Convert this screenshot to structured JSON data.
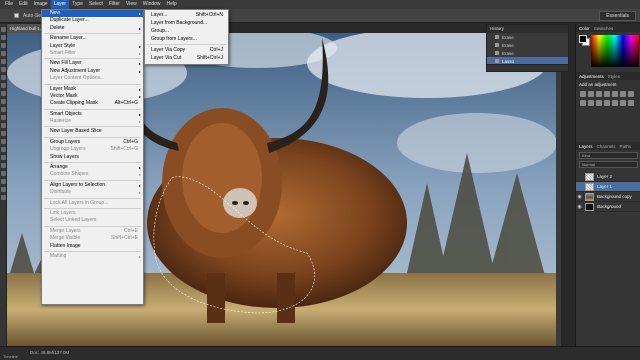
{
  "menubar": [
    "File",
    "Edit",
    "Image",
    "Layer",
    "Type",
    "Select",
    "Filter",
    "View",
    "Window",
    "Help"
  ],
  "options": {
    "auto_select": "Auto-Select:",
    "workspace": "Essentials"
  },
  "document_tab": "Highland bull 1.jpg @ 66.7% (Layer 1, RGB/8) *",
  "status_doc": "Doc: 46.8M/137.0M",
  "timeline": "Timeline",
  "layer_menu": [
    {
      "label": "New",
      "highlighted": true,
      "arrow": true
    },
    {
      "label": "Duplicate Layer..."
    },
    {
      "label": "Delete",
      "arrow": true
    },
    {
      "sep": true
    },
    {
      "label": "Rename Layer..."
    },
    {
      "label": "Layer Style",
      "arrow": true
    },
    {
      "label": "Smart Filter",
      "disabled": true,
      "arrow": true
    },
    {
      "sep": true
    },
    {
      "label": "New Fill Layer",
      "arrow": true
    },
    {
      "label": "New Adjustment Layer",
      "arrow": true
    },
    {
      "label": "Layer Content Options...",
      "disabled": true
    },
    {
      "sep": true
    },
    {
      "label": "Layer Mask",
      "arrow": true
    },
    {
      "label": "Vector Mask",
      "arrow": true
    },
    {
      "label": "Create Clipping Mask",
      "shortcut": "Alt+Ctrl+G"
    },
    {
      "sep": true
    },
    {
      "label": "Smart Objects",
      "arrow": true
    },
    {
      "label": "Rasterize",
      "disabled": true,
      "arrow": true
    },
    {
      "sep": true
    },
    {
      "label": "New Layer Based Slice"
    },
    {
      "sep": true
    },
    {
      "label": "Group Layers",
      "shortcut": "Ctrl+G"
    },
    {
      "label": "Ungroup Layers",
      "shortcut": "Shift+Ctrl+G",
      "disabled": true
    },
    {
      "label": "Show Layers"
    },
    {
      "sep": true
    },
    {
      "label": "Arrange",
      "arrow": true
    },
    {
      "label": "Combine Shapes",
      "disabled": true,
      "arrow": true
    },
    {
      "sep": true
    },
    {
      "label": "Align Layers to Selection",
      "arrow": true
    },
    {
      "label": "Distribute",
      "disabled": true,
      "arrow": true
    },
    {
      "sep": true
    },
    {
      "label": "Lock All Layers in Group...",
      "disabled": true
    },
    {
      "sep": true
    },
    {
      "label": "Link Layers",
      "disabled": true
    },
    {
      "label": "Select Linked Layers",
      "disabled": true
    },
    {
      "sep": true
    },
    {
      "label": "Merge Layers",
      "shortcut": "Ctrl+E",
      "disabled": true
    },
    {
      "label": "Merge Visible",
      "shortcut": "Shift+Ctrl+E",
      "disabled": true
    },
    {
      "label": "Flatten Image"
    },
    {
      "sep": true
    },
    {
      "label": "Matting",
      "disabled": true,
      "arrow": true
    }
  ],
  "new_submenu": [
    {
      "label": "Layer...",
      "shortcut": "Shift+Ctrl+N"
    },
    {
      "label": "Layer from Background..."
    },
    {
      "label": "Group..."
    },
    {
      "label": "Group from Layers..."
    },
    {
      "sep": true
    },
    {
      "label": "Layer Via Copy",
      "shortcut": "Ctrl+J"
    },
    {
      "label": "Layer Via Cut",
      "shortcut": "Shift+Ctrl+J"
    }
  ],
  "history": {
    "title": "History",
    "items": [
      {
        "label": "Erase"
      },
      {
        "label": "Erase"
      },
      {
        "label": "Erase"
      },
      {
        "label": "Lasso",
        "selected": true
      }
    ]
  },
  "color_tabs": [
    "Color",
    "Swatches"
  ],
  "adjust_tabs": [
    "Adjustments",
    "Styles"
  ],
  "adjust_title": "Add an adjustment",
  "layers_tabs": [
    "Layers",
    "Channels",
    "Paths"
  ],
  "layers_kind": "Kind",
  "layers_blend": "Normal",
  "layers": [
    {
      "name": "Layer 2",
      "thumb": "chk",
      "visible": false,
      "italic": false,
      "selected": false
    },
    {
      "name": "Layer 1",
      "thumb": "chk",
      "visible": false,
      "italic": false,
      "selected": true
    },
    {
      "name": "Background copy",
      "thumb": "img",
      "visible": true,
      "italic": false,
      "selected": false
    },
    {
      "name": "Background",
      "thumb": "blk",
      "visible": true,
      "italic": true,
      "selected": false
    }
  ],
  "colors": {
    "menu_highlight": "#1f5fbf",
    "layer_selected": "#4b6ea0"
  }
}
